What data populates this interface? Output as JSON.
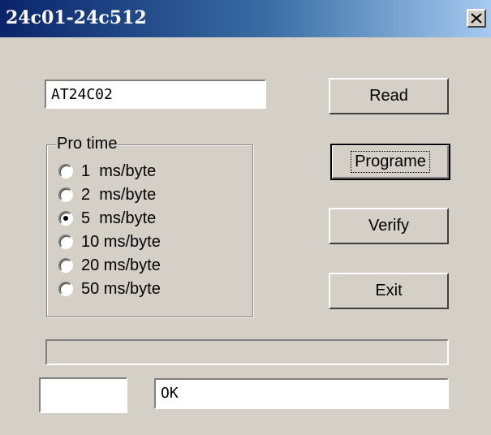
{
  "window": {
    "title": "24c01-24c512"
  },
  "chip_field": {
    "value": "AT24C02"
  },
  "buttons": {
    "read": "Read",
    "program": "Programe",
    "verify": "Verify",
    "exit": "Exit"
  },
  "pro_time": {
    "label": "Pro time",
    "selected_index": 2,
    "options": [
      "1  ms/byte",
      "2  ms/byte",
      "5  ms/byte",
      "10 ms/byte",
      "20 ms/byte",
      "50 ms/byte"
    ]
  },
  "progress": {
    "fraction": 0
  },
  "small_field": {
    "value": ""
  },
  "status_field": {
    "value": "OK"
  }
}
